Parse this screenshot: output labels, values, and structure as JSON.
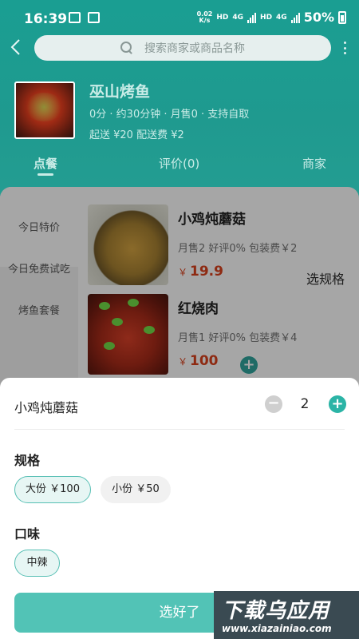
{
  "status_bar": {
    "time": "16:39",
    "net_speed": "0.02",
    "net_unit": "K/s",
    "hd1": "HD",
    "net1": "4G",
    "hd2": "HD",
    "net2": "4G",
    "battery": "50%"
  },
  "search": {
    "placeholder": "搜索商家或商品名称"
  },
  "store": {
    "name": "巫山烤鱼",
    "meta": "0分 · 约30分钟 · 月售0 · 支持自取",
    "fee": "起送 ¥20 配送费 ¥2"
  },
  "tabs": [
    {
      "label": "点餐",
      "active": true
    },
    {
      "label": "评价(0)",
      "active": false
    },
    {
      "label": "商家",
      "active": false
    }
  ],
  "categories": [
    {
      "label": "今日特价",
      "active": true
    },
    {
      "label": "今日免费试吃",
      "active": false
    },
    {
      "label": "烤鱼套餐",
      "active": false
    }
  ],
  "dishes": [
    {
      "name": "小鸡炖蘑菇",
      "stats": "月售2   好评0%   包装费￥2",
      "currency": "￥",
      "price": "19.9",
      "action": "选规格"
    },
    {
      "name": "红烧肉",
      "stats": "月售1   好评0%   包装费￥4",
      "currency": "￥",
      "price": "100",
      "action": "+"
    }
  ],
  "sheet": {
    "title": "小鸡炖蘑菇",
    "quantity": "2",
    "minus": "−",
    "plus": "+",
    "spec_label": "规格",
    "specs": [
      {
        "label": "大份 ￥100",
        "selected": true
      },
      {
        "label": "小份 ￥50",
        "selected": false
      }
    ],
    "taste_label": "口味",
    "tastes": [
      {
        "label": "中辣",
        "selected": true
      }
    ],
    "confirm": "选好了"
  },
  "watermark": {
    "main": "下载乌应用",
    "sub": "www.xiazainiao.com"
  },
  "colors": {
    "header": "#1f9a8f",
    "accent": "#2bb4a6",
    "price": "#8e2a12"
  }
}
